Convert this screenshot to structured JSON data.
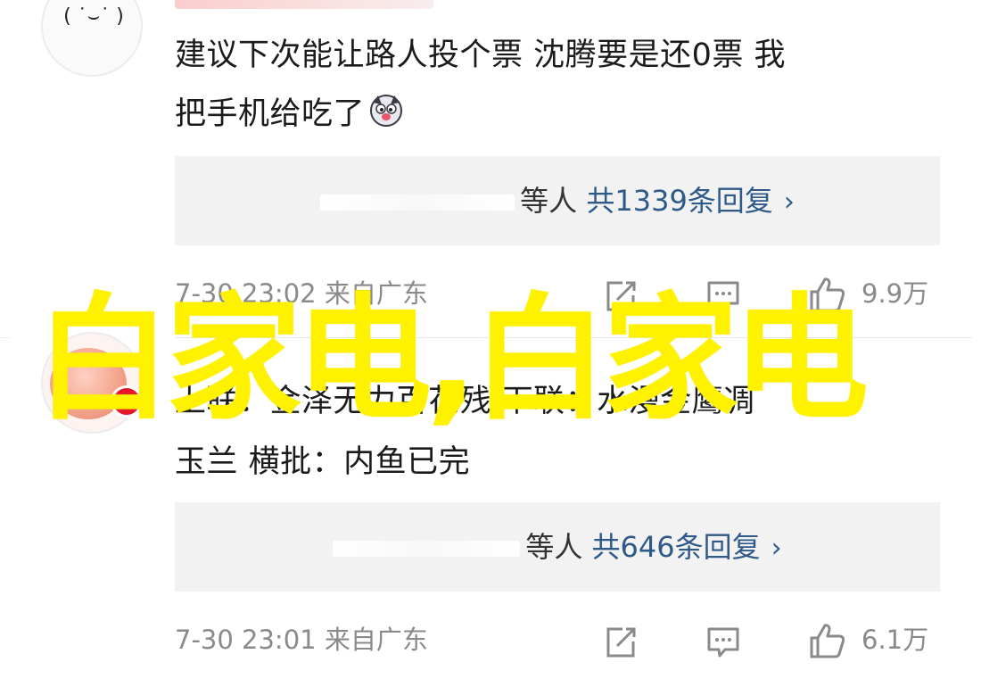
{
  "comments": [
    {
      "text_line1": "建议下次能让路人投个票 沈腾要是还0票 我",
      "text_line2": "把手机给吃了",
      "emoji": "dog-emoji",
      "reply_summary": {
        "suffix": "等人",
        "count_label": "共1339条回复",
        "chevron": "›"
      },
      "meta": {
        "time_location": "7-30 23:02 来自广东",
        "likes": "9.9万"
      }
    },
    {
      "text_line1": "上联：金泽无力百花残 下联：水漫金鹰凋",
      "text_line2": "玉兰 横批：内鱼已完",
      "reply_summary": {
        "suffix": "等人",
        "count_label": "共646条回复",
        "chevron": "›"
      },
      "meta": {
        "time_location": "7-30 23:01 来自广东",
        "likes": "6.1万"
      }
    }
  ],
  "watermark": "白家电,白家电",
  "colors": {
    "link": "#2e5a8a",
    "meta": "#8a8a8a",
    "reply_bg": "#f2f2f2",
    "watermark": "#fff200"
  }
}
